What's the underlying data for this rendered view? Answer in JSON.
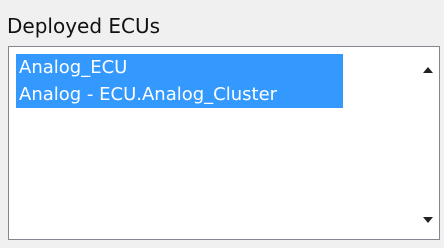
{
  "panel": {
    "title": "Deployed ECUs"
  },
  "deployed_ecus": {
    "items": [
      {
        "label": "Analog_ECU",
        "selected": true
      },
      {
        "label": "Analog - ECU.Analog_Cluster",
        "selected": true
      }
    ]
  },
  "scrollbar": {
    "up_icon": "arrow-up-icon",
    "down_icon": "arrow-down-icon"
  },
  "colors": {
    "selection": "#3399ff",
    "selection_text": "#ffffff",
    "panel_background": "#f0f0f0",
    "list_border": "#828790"
  }
}
